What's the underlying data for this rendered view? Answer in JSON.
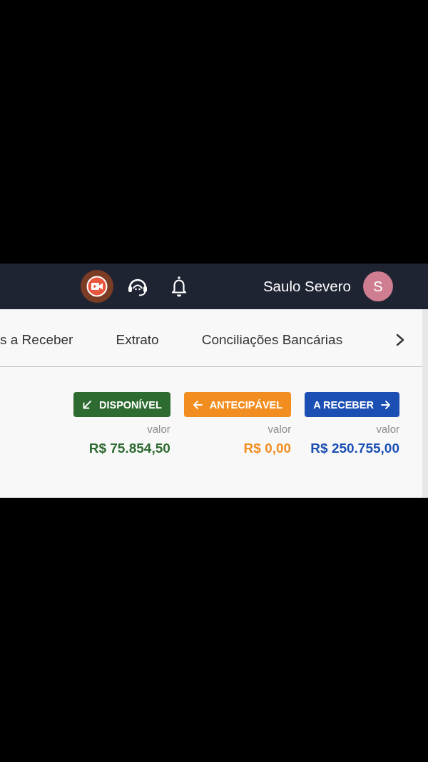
{
  "header": {
    "user_name": "Saulo Severo",
    "avatar_initial": "S"
  },
  "tabs": [
    {
      "label": "s a Receber"
    },
    {
      "label": "Extrato"
    },
    {
      "label": "Conciliações Bancárias"
    }
  ],
  "balances": [
    {
      "kind": "available",
      "label": "DISPONÍVEL",
      "caption": "valor",
      "amount": "R$ 75.854,50",
      "color": "#2e6b31"
    },
    {
      "kind": "advance",
      "label": "ANTECIPÁVEL",
      "caption": "valor",
      "amount": "R$ 0,00",
      "color": "#f28d1f"
    },
    {
      "kind": "receivable",
      "label": "A RECEBER",
      "caption": "valor",
      "amount": "R$ 250.755,00",
      "color": "#1b4fb4"
    }
  ]
}
